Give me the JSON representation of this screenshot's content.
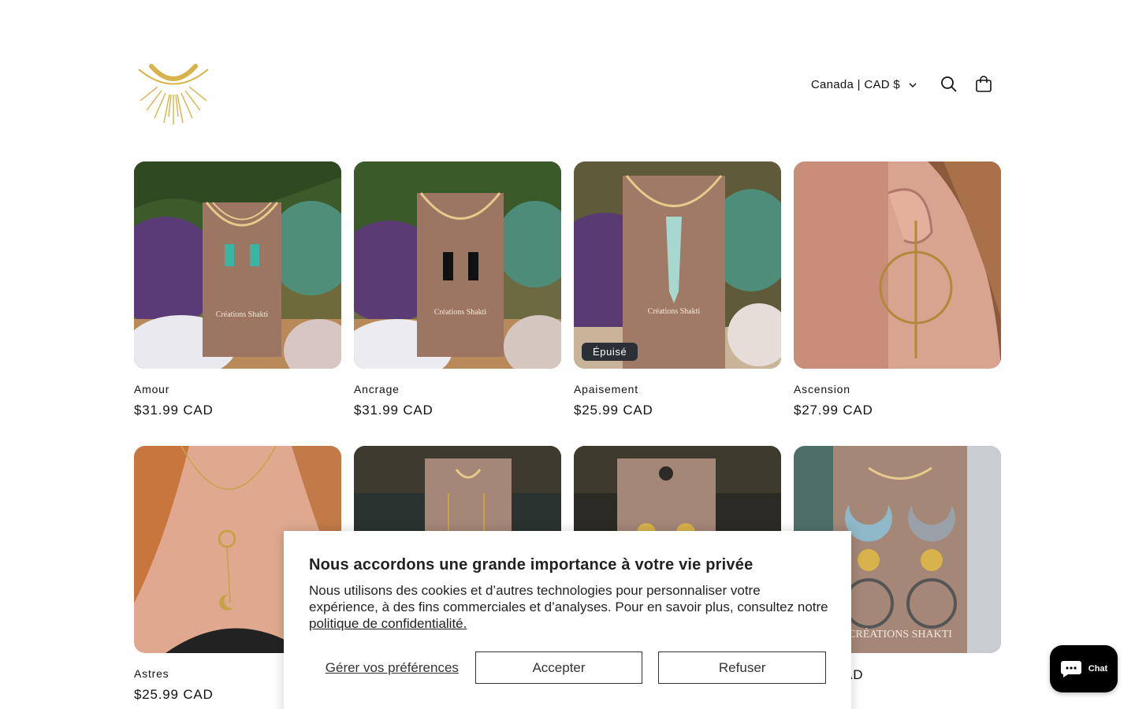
{
  "header": {
    "logo_alt": "Créations Shakti",
    "country_selector": "Canada | CAD $",
    "icons": [
      "search-icon",
      "cart-icon"
    ]
  },
  "products": [
    {
      "title": "Amour",
      "price": "$31.99 CAD",
      "badge": "",
      "image": "turquoise-earrings"
    },
    {
      "title": "Ancrage",
      "price": "$31.99 CAD",
      "badge": "",
      "image": "black-tourmaline-earrings"
    },
    {
      "title": "Apaisement",
      "price": "$25.99 CAD",
      "badge": "Épuisé",
      "image": "aquamarine-pendant"
    },
    {
      "title": "Ascension",
      "price": "$27.99 CAD",
      "badge": "",
      "image": "gold-hoop-earring"
    },
    {
      "title": "Astres",
      "price": "$25.99 CAD",
      "badge": "",
      "image": "sun-moon-necklace"
    },
    {
      "title": "",
      "price": "",
      "badge": "",
      "image": "gold-drop-earrings"
    },
    {
      "title": "",
      "price": "",
      "badge": "",
      "image": "gold-disc-earrings"
    },
    {
      "title": "",
      "price": "CAD",
      "badge": "",
      "image": "moon-snake-earrings"
    }
  ],
  "cookie_banner": {
    "title": "Nous accordons une grande importance à votre vie privée",
    "body": "Nous utilisons des cookies et d’autres technologies pour personnaliser votre expérience, à des fins commerciales et d’analyses. Pour en savoir plus, consultez notre",
    "link": "politique de confidentialité.",
    "manage": "Gérer vos préférences",
    "accept": "Accepter",
    "decline": "Refuser"
  },
  "chat": {
    "label": "Chat"
  },
  "colors": {
    "gold": "#d8b24a",
    "text": "#121212",
    "badge": "#2b2f36"
  }
}
